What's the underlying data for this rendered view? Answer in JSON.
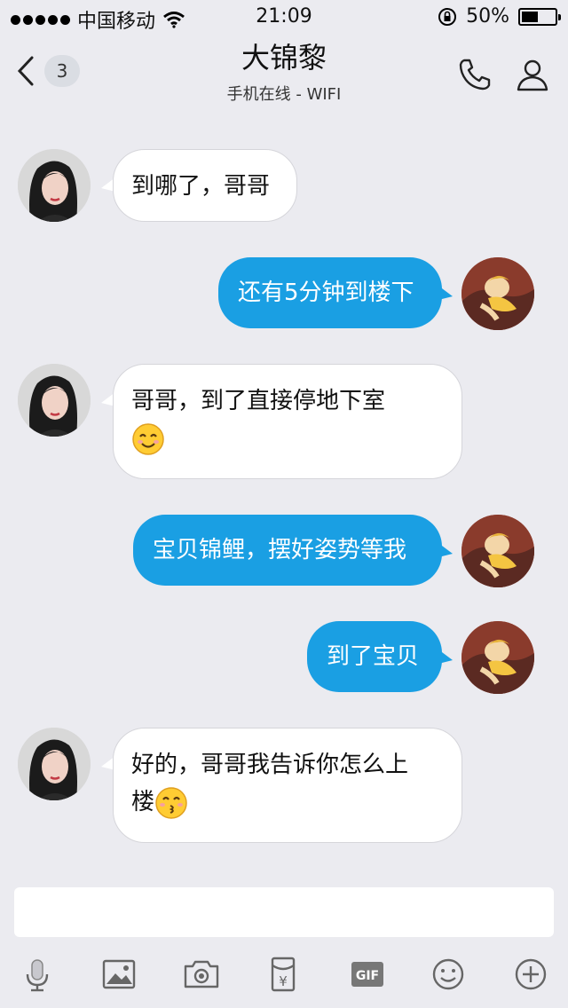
{
  "status_bar": {
    "carrier": "中国移动",
    "time": "21:09",
    "battery_percent": "50%",
    "battery_level": 0.5
  },
  "header": {
    "back_badge_count": "3",
    "title": "大锦黎",
    "subtitle": "手机在线 - WIFI"
  },
  "messages": [
    {
      "side": "left",
      "text": "到哪了，哥哥"
    },
    {
      "side": "right",
      "text": "还有5分钟到楼下"
    },
    {
      "side": "left",
      "text": "哥哥，到了直接停地下室",
      "emoji": "smiling-face-icon"
    },
    {
      "side": "right",
      "text": "宝贝锦鲤，摆好姿势等我"
    },
    {
      "side": "right",
      "text": "到了宝贝"
    },
    {
      "side": "left",
      "text_line1": "好的，哥哥我告诉你怎么上",
      "text_line2": "楼",
      "emoji": "kissing-face-icon"
    }
  ],
  "toolbar": {
    "items": [
      "mic-icon",
      "image-icon",
      "camera-icon",
      "red-packet-icon",
      "gif-icon",
      "emoji-icon",
      "plus-icon"
    ],
    "gif_label": "GIF",
    "yen_label": "¥"
  },
  "colors": {
    "background": "#ebebf0",
    "outgoing_bubble": "#1a9fe3",
    "incoming_bubble": "#ffffff"
  }
}
